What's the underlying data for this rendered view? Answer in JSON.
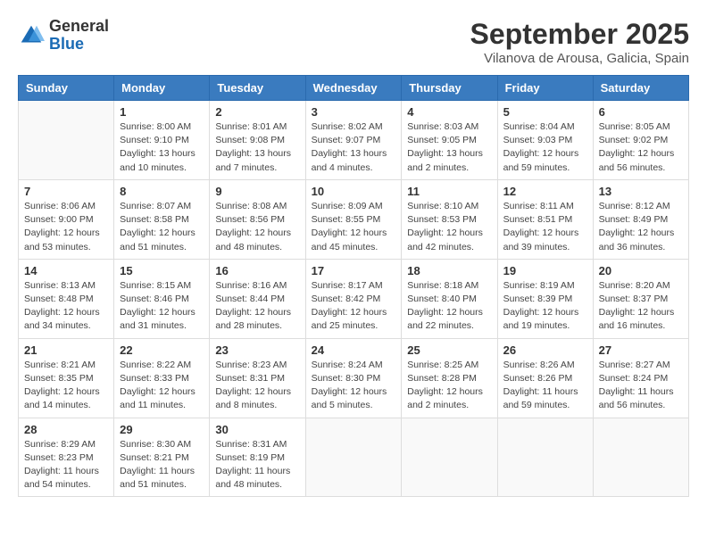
{
  "logo": {
    "general": "General",
    "blue": "Blue"
  },
  "title": "September 2025",
  "location": "Vilanova de Arousa, Galicia, Spain",
  "headers": [
    "Sunday",
    "Monday",
    "Tuesday",
    "Wednesday",
    "Thursday",
    "Friday",
    "Saturday"
  ],
  "weeks": [
    [
      {
        "day": "",
        "info": ""
      },
      {
        "day": "1",
        "info": "Sunrise: 8:00 AM\nSunset: 9:10 PM\nDaylight: 13 hours\nand 10 minutes."
      },
      {
        "day": "2",
        "info": "Sunrise: 8:01 AM\nSunset: 9:08 PM\nDaylight: 13 hours\nand 7 minutes."
      },
      {
        "day": "3",
        "info": "Sunrise: 8:02 AM\nSunset: 9:07 PM\nDaylight: 13 hours\nand 4 minutes."
      },
      {
        "day": "4",
        "info": "Sunrise: 8:03 AM\nSunset: 9:05 PM\nDaylight: 13 hours\nand 2 minutes."
      },
      {
        "day": "5",
        "info": "Sunrise: 8:04 AM\nSunset: 9:03 PM\nDaylight: 12 hours\nand 59 minutes."
      },
      {
        "day": "6",
        "info": "Sunrise: 8:05 AM\nSunset: 9:02 PM\nDaylight: 12 hours\nand 56 minutes."
      }
    ],
    [
      {
        "day": "7",
        "info": "Sunrise: 8:06 AM\nSunset: 9:00 PM\nDaylight: 12 hours\nand 53 minutes."
      },
      {
        "day": "8",
        "info": "Sunrise: 8:07 AM\nSunset: 8:58 PM\nDaylight: 12 hours\nand 51 minutes."
      },
      {
        "day": "9",
        "info": "Sunrise: 8:08 AM\nSunset: 8:56 PM\nDaylight: 12 hours\nand 48 minutes."
      },
      {
        "day": "10",
        "info": "Sunrise: 8:09 AM\nSunset: 8:55 PM\nDaylight: 12 hours\nand 45 minutes."
      },
      {
        "day": "11",
        "info": "Sunrise: 8:10 AM\nSunset: 8:53 PM\nDaylight: 12 hours\nand 42 minutes."
      },
      {
        "day": "12",
        "info": "Sunrise: 8:11 AM\nSunset: 8:51 PM\nDaylight: 12 hours\nand 39 minutes."
      },
      {
        "day": "13",
        "info": "Sunrise: 8:12 AM\nSunset: 8:49 PM\nDaylight: 12 hours\nand 36 minutes."
      }
    ],
    [
      {
        "day": "14",
        "info": "Sunrise: 8:13 AM\nSunset: 8:48 PM\nDaylight: 12 hours\nand 34 minutes."
      },
      {
        "day": "15",
        "info": "Sunrise: 8:15 AM\nSunset: 8:46 PM\nDaylight: 12 hours\nand 31 minutes."
      },
      {
        "day": "16",
        "info": "Sunrise: 8:16 AM\nSunset: 8:44 PM\nDaylight: 12 hours\nand 28 minutes."
      },
      {
        "day": "17",
        "info": "Sunrise: 8:17 AM\nSunset: 8:42 PM\nDaylight: 12 hours\nand 25 minutes."
      },
      {
        "day": "18",
        "info": "Sunrise: 8:18 AM\nSunset: 8:40 PM\nDaylight: 12 hours\nand 22 minutes."
      },
      {
        "day": "19",
        "info": "Sunrise: 8:19 AM\nSunset: 8:39 PM\nDaylight: 12 hours\nand 19 minutes."
      },
      {
        "day": "20",
        "info": "Sunrise: 8:20 AM\nSunset: 8:37 PM\nDaylight: 12 hours\nand 16 minutes."
      }
    ],
    [
      {
        "day": "21",
        "info": "Sunrise: 8:21 AM\nSunset: 8:35 PM\nDaylight: 12 hours\nand 14 minutes."
      },
      {
        "day": "22",
        "info": "Sunrise: 8:22 AM\nSunset: 8:33 PM\nDaylight: 12 hours\nand 11 minutes."
      },
      {
        "day": "23",
        "info": "Sunrise: 8:23 AM\nSunset: 8:31 PM\nDaylight: 12 hours\nand 8 minutes."
      },
      {
        "day": "24",
        "info": "Sunrise: 8:24 AM\nSunset: 8:30 PM\nDaylight: 12 hours\nand 5 minutes."
      },
      {
        "day": "25",
        "info": "Sunrise: 8:25 AM\nSunset: 8:28 PM\nDaylight: 12 hours\nand 2 minutes."
      },
      {
        "day": "26",
        "info": "Sunrise: 8:26 AM\nSunset: 8:26 PM\nDaylight: 11 hours\nand 59 minutes."
      },
      {
        "day": "27",
        "info": "Sunrise: 8:27 AM\nSunset: 8:24 PM\nDaylight: 11 hours\nand 56 minutes."
      }
    ],
    [
      {
        "day": "28",
        "info": "Sunrise: 8:29 AM\nSunset: 8:23 PM\nDaylight: 11 hours\nand 54 minutes."
      },
      {
        "day": "29",
        "info": "Sunrise: 8:30 AM\nSunset: 8:21 PM\nDaylight: 11 hours\nand 51 minutes."
      },
      {
        "day": "30",
        "info": "Sunrise: 8:31 AM\nSunset: 8:19 PM\nDaylight: 11 hours\nand 48 minutes."
      },
      {
        "day": "",
        "info": ""
      },
      {
        "day": "",
        "info": ""
      },
      {
        "day": "",
        "info": ""
      },
      {
        "day": "",
        "info": ""
      }
    ]
  ]
}
